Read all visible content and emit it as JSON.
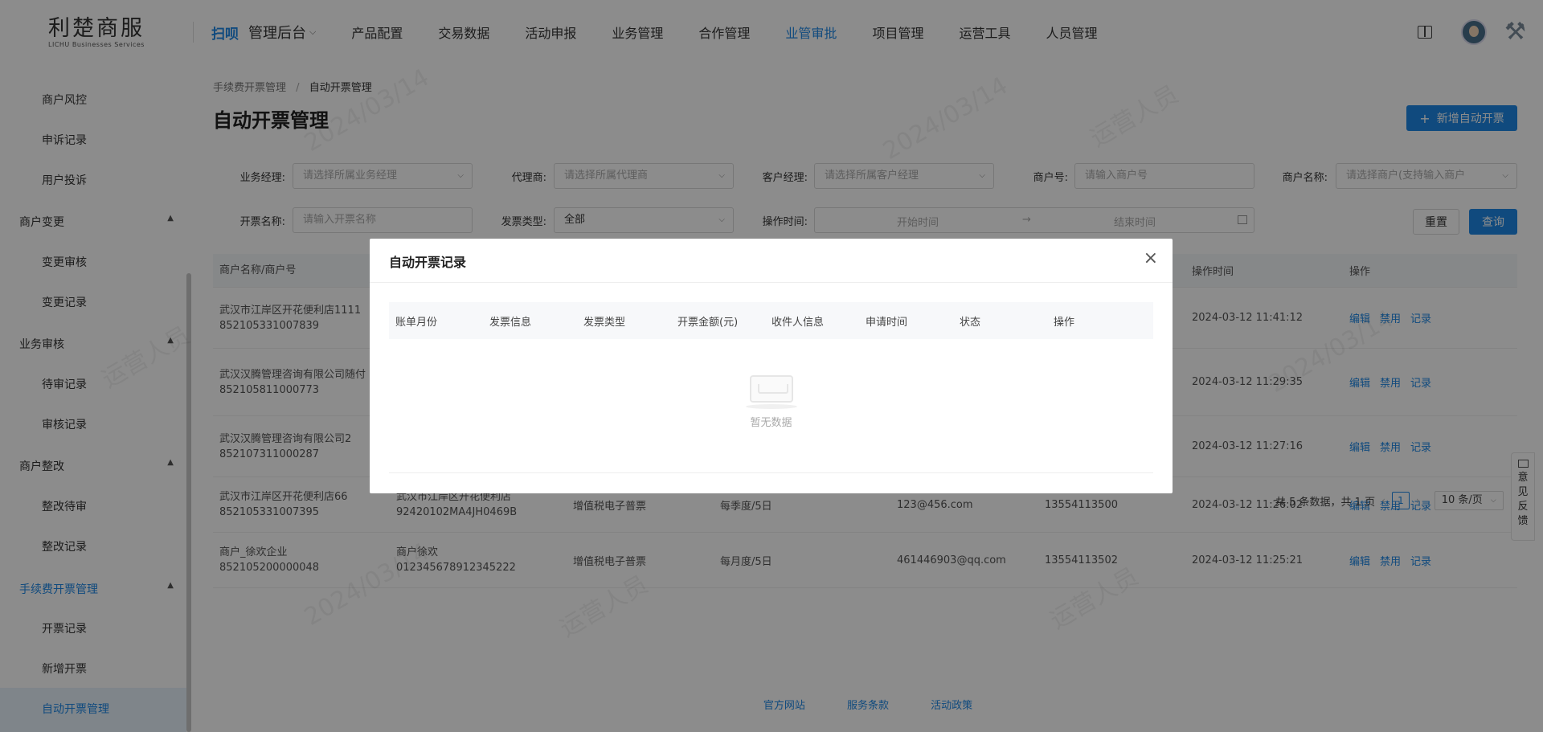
{
  "header": {
    "logo_main": "利楚商服",
    "logo_sub": "LICHU Businesses Services",
    "scan": "扫呗",
    "admin": "管理后台",
    "nav": [
      "产品配置",
      "交易数据",
      "活动申报",
      "业务管理",
      "合作管理",
      "业管审批",
      "项目管理",
      "运营工具",
      "人员管理"
    ],
    "active_nav": "业管审批"
  },
  "sidebar": {
    "items": [
      {
        "label": "商户风控",
        "type": "item"
      },
      {
        "label": "申诉记录",
        "type": "item"
      },
      {
        "label": "用户投诉",
        "type": "item"
      },
      {
        "label": "商户变更",
        "type": "group"
      },
      {
        "label": "变更审核",
        "type": "item"
      },
      {
        "label": "变更记录",
        "type": "item"
      },
      {
        "label": "业务审核",
        "type": "group"
      },
      {
        "label": "待审记录",
        "type": "item"
      },
      {
        "label": "审核记录",
        "type": "item"
      },
      {
        "label": "商户整改",
        "type": "group"
      },
      {
        "label": "整改待审",
        "type": "item"
      },
      {
        "label": "整改记录",
        "type": "item"
      },
      {
        "label": "手续费开票管理",
        "type": "group"
      },
      {
        "label": "开票记录",
        "type": "item"
      },
      {
        "label": "新增开票",
        "type": "item"
      },
      {
        "label": "自动开票管理",
        "type": "item"
      }
    ]
  },
  "breadcrumb": {
    "parent": "手续费开票管理",
    "separator": "/",
    "current": "自动开票管理"
  },
  "page_title": "自动开票管理",
  "add_button": "新增自动开票",
  "filters": {
    "manager_label": "业务经理:",
    "manager_placeholder": "请选择所属业务经理",
    "agent_label": "代理商:",
    "agent_placeholder": "请选择所属代理商",
    "client_manager_label": "客户经理:",
    "client_manager_placeholder": "请选择所属客户经理",
    "merchant_no_label": "商户号:",
    "merchant_no_placeholder": "请输入商户号",
    "merchant_name_label": "商户名称:",
    "merchant_name_placeholder": "请选择商户(支持输入商户",
    "invoice_name_label": "开票名称:",
    "invoice_name_placeholder": "请输入开票名称",
    "invoice_type_label": "发票类型:",
    "invoice_type_value": "全部",
    "op_time_label": "操作时间:",
    "start_placeholder": "开始时间",
    "end_placeholder": "结束时间",
    "range_arrow": "→",
    "reset": "重置",
    "query": "查询"
  },
  "table": {
    "headers": [
      "商户名称/商户号",
      "",
      "",
      "",
      "",
      "",
      "操作时间",
      "操作"
    ],
    "rows": [
      {
        "merchant": "武汉市江岸区开花便利店1111",
        "merchant_no": "852105331007839",
        "title": "",
        "tax_no": "",
        "type": "",
        "cycle": "",
        "email": "",
        "phone": "",
        "time": "2024-03-12 11:41:12"
      },
      {
        "merchant": "武汉汉腾管理咨询有限公司随付",
        "merchant_no": "852105811000773",
        "title": "",
        "tax_no": "",
        "type": "",
        "cycle": "",
        "email": "",
        "phone": "",
        "time": "2024-03-12 11:29:35"
      },
      {
        "merchant": "武汉汉腾管理咨询有限公司2",
        "merchant_no": "852107311000287",
        "title": "",
        "tax_no": "",
        "type": "",
        "cycle": "",
        "email": "",
        "phone": "",
        "time": "2024-03-12 11:27:16"
      },
      {
        "merchant": "武汉市江岸区开花便利店66",
        "merchant_no": "852105331007395",
        "title": "武汉市江岸区开花便利店",
        "tax_no": "92420102MA4JH0469B",
        "type": "增值税电子普票",
        "cycle": "每季度/5日",
        "email": "123@456.com",
        "phone": "13554113500",
        "time": "2024-03-12 11:26:02"
      },
      {
        "merchant": "商户_徐欢企业",
        "merchant_no": "852105200000048",
        "title": "商户徐欢",
        "tax_no": "012345678912345222",
        "type": "增值税电子普票",
        "cycle": "每月度/5日",
        "email": "461446903@qq.com",
        "phone": "13554113502",
        "time": "2024-03-12 11:25:21"
      }
    ],
    "ops": [
      "编辑",
      "禁用",
      "记录"
    ]
  },
  "pager": {
    "total": "共 5 条数据，共 1 页",
    "prev": "‹",
    "page": "1",
    "next": "›",
    "size": "10 条/页"
  },
  "footer": [
    "官方网站",
    "服务条款",
    "活动政策"
  ],
  "feedback": [
    "意",
    "见",
    "反",
    "馈"
  ],
  "watermark": {
    "date": "2024/03/14",
    "name": "运营人员"
  },
  "modal": {
    "title": "自动开票记录",
    "close": "×",
    "headers": [
      "账单月份",
      "发票信息",
      "发票类型",
      "开票金额(元)",
      "收件人信息",
      "申请时间",
      "状态",
      "操作"
    ],
    "empty_text": "暂无数据"
  },
  "colors": {
    "accent": "#1e88e5",
    "mask": "rgba(0,0,0,0.45)"
  }
}
